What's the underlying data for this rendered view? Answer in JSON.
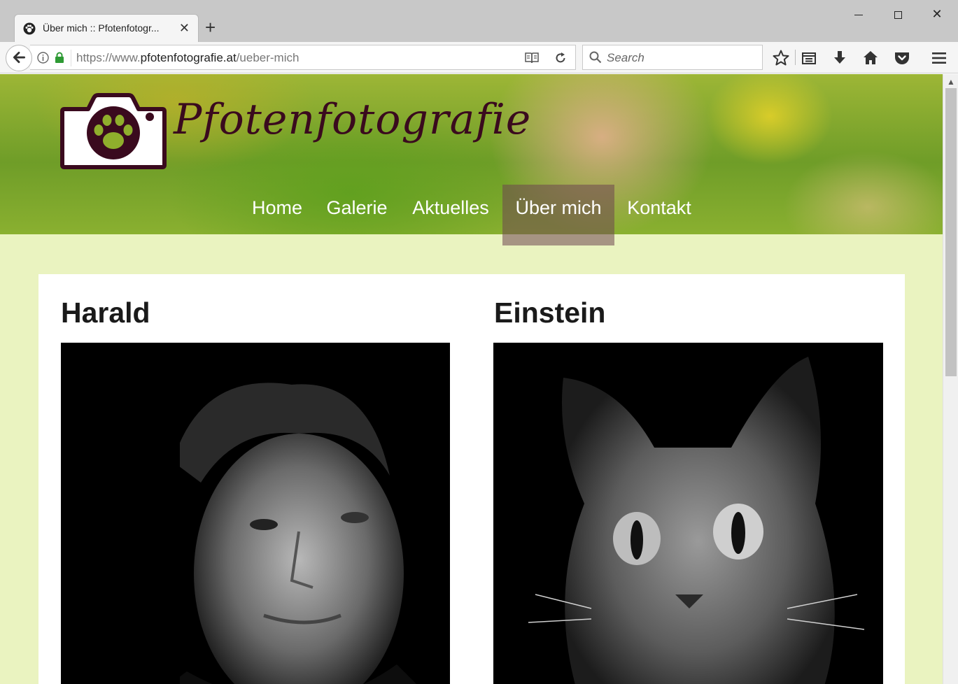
{
  "browser": {
    "tab_title": "Über mich :: Pfotenfotogr...",
    "tab_close": "✕",
    "new_tab": "+",
    "window_close": "✕",
    "url_prefix": "https://www.",
    "url_domain": "pfotenfotografie.at",
    "url_path": "/ueber-mich",
    "search_placeholder": "Search",
    "icons": [
      "back-icon",
      "info-icon",
      "lock-icon",
      "reader-view-icon",
      "reload-icon",
      "search-icon",
      "bookmark-star-icon",
      "library-icon",
      "download-icon",
      "home-icon",
      "pocket-icon",
      "menu-icon"
    ]
  },
  "site": {
    "logo_text": "Pfotenfotografie",
    "nav": [
      {
        "label": "Home"
      },
      {
        "label": "Galerie"
      },
      {
        "label": "Aktuelles"
      },
      {
        "label": "Über mich",
        "active": true
      },
      {
        "label": "Kontakt"
      }
    ]
  },
  "content": {
    "col1_title": "Harald",
    "col2_title": "Einstein"
  },
  "colors": {
    "page_bg": "#eaf3c0",
    "logo": "#3a0a1e",
    "active_nav": "#6e4650"
  }
}
